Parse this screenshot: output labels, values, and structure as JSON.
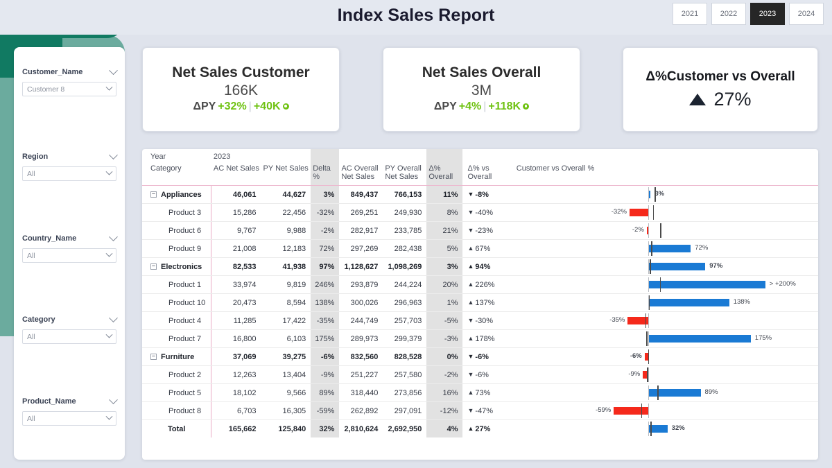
{
  "header": {
    "title": "Index Sales Report",
    "years": [
      {
        "label": "2021",
        "active": false
      },
      {
        "label": "2022",
        "active": false
      },
      {
        "label": "2023",
        "active": true
      },
      {
        "label": "2024",
        "active": false
      }
    ]
  },
  "filters": [
    {
      "label": "Customer_Name",
      "value": "Customer 8"
    },
    {
      "label": "Region",
      "value": "All"
    },
    {
      "label": "Country_Name",
      "value": "All"
    },
    {
      "label": "Category",
      "value": "All"
    },
    {
      "label": "Product_Name",
      "value": "All"
    }
  ],
  "kpis": {
    "customer": {
      "title": "Net Sales Customer",
      "value": "166K",
      "delta_label": "ΔPY",
      "delta_pct": "+32%",
      "delta_abs": "+40K"
    },
    "overall": {
      "title": "Net Sales Overall",
      "value": "3M",
      "delta_label": "ΔPY",
      "delta_pct": "+4%",
      "delta_abs": "+118K"
    },
    "compare": {
      "title": "Δ%Customer vs Overall",
      "value": "27%",
      "direction": "up"
    }
  },
  "table": {
    "year_label": "Year",
    "year_value": "2023",
    "columns": [
      "Category",
      "AC Net Sales",
      "PY Net Sales",
      "Delta %",
      "AC Overall Net Sales",
      "PY Overall Net Sales",
      "Δ% Overall",
      "Δ% vs Overall",
      "Customer vs Overall %"
    ],
    "rows": [
      {
        "category": "Appliances",
        "type": "group",
        "ac_net_sales": "46,061",
        "py_net_sales": "44,627",
        "delta_pct": "3%",
        "ac_overall": "849,437",
        "py_overall": "766,153",
        "d_overall": "11%",
        "d_vs_overall": "-8%",
        "dir": "down",
        "bar_value": 3,
        "bar_label": "3%",
        "ref": 11
      },
      {
        "category": "Product 3",
        "type": "child",
        "ac_net_sales": "15,286",
        "py_net_sales": "22,456",
        "delta_pct": "-32%",
        "ac_overall": "269,251",
        "py_overall": "249,930",
        "d_overall": "8%",
        "d_vs_overall": "-40%",
        "dir": "down",
        "bar_value": -32,
        "bar_label": "-32%",
        "ref": 8
      },
      {
        "category": "Product 6",
        "type": "child",
        "ac_net_sales": "9,767",
        "py_net_sales": "9,988",
        "delta_pct": "-2%",
        "ac_overall": "282,917",
        "py_overall": "233,785",
        "d_overall": "21%",
        "d_vs_overall": "-23%",
        "dir": "down",
        "bar_value": -2,
        "bar_label": "-2%",
        "ref": 21
      },
      {
        "category": "Product 9",
        "type": "child",
        "ac_net_sales": "21,008",
        "py_net_sales": "12,183",
        "delta_pct": "72%",
        "ac_overall": "297,269",
        "py_overall": "282,438",
        "d_overall": "5%",
        "d_vs_overall": "67%",
        "dir": "up",
        "bar_value": 72,
        "bar_label": "72%",
        "ref": 5
      },
      {
        "category": "Electronics",
        "type": "group",
        "ac_net_sales": "82,533",
        "py_net_sales": "41,938",
        "delta_pct": "97%",
        "ac_overall": "1,128,627",
        "py_overall": "1,098,269",
        "d_overall": "3%",
        "d_vs_overall": "94%",
        "dir": "up",
        "bar_value": 97,
        "bar_label": "97%",
        "ref": 3
      },
      {
        "category": "Product 1",
        "type": "child",
        "ac_net_sales": "33,974",
        "py_net_sales": "9,819",
        "delta_pct": "246%",
        "ac_overall": "293,879",
        "py_overall": "244,224",
        "d_overall": "20%",
        "d_vs_overall": "226%",
        "dir": "up",
        "bar_value": 200,
        "bar_label": "> +200%",
        "ref": 20
      },
      {
        "category": "Product 10",
        "type": "child",
        "ac_net_sales": "20,473",
        "py_net_sales": "8,594",
        "delta_pct": "138%",
        "ac_overall": "300,026",
        "py_overall": "296,963",
        "d_overall": "1%",
        "d_vs_overall": "137%",
        "dir": "up",
        "bar_value": 138,
        "bar_label": "138%",
        "ref": 1
      },
      {
        "category": "Product 4",
        "type": "child",
        "ac_net_sales": "11,285",
        "py_net_sales": "17,422",
        "delta_pct": "-35%",
        "ac_overall": "244,749",
        "py_overall": "257,703",
        "d_overall": "-5%",
        "d_vs_overall": "-30%",
        "dir": "down",
        "bar_value": -35,
        "bar_label": "-35%",
        "ref": -5
      },
      {
        "category": "Product 7",
        "type": "child",
        "ac_net_sales": "16,800",
        "py_net_sales": "6,103",
        "delta_pct": "175%",
        "ac_overall": "289,973",
        "py_overall": "299,379",
        "d_overall": "-3%",
        "d_vs_overall": "178%",
        "dir": "up",
        "bar_value": 175,
        "bar_label": "175%",
        "ref": -3
      },
      {
        "category": "Furniture",
        "type": "group",
        "ac_net_sales": "37,069",
        "py_net_sales": "39,275",
        "delta_pct": "-6%",
        "ac_overall": "832,560",
        "py_overall": "828,528",
        "d_overall": "0%",
        "d_vs_overall": "-6%",
        "dir": "down",
        "bar_value": -6,
        "bar_label": "-6%",
        "ref": 0
      },
      {
        "category": "Product 2",
        "type": "child",
        "ac_net_sales": "12,263",
        "py_net_sales": "13,404",
        "delta_pct": "-9%",
        "ac_overall": "251,227",
        "py_overall": "257,580",
        "d_overall": "-2%",
        "d_vs_overall": "-6%",
        "dir": "down",
        "bar_value": -9,
        "bar_label": "-9%",
        "ref": -2
      },
      {
        "category": "Product 5",
        "type": "child",
        "ac_net_sales": "18,102",
        "py_net_sales": "9,566",
        "delta_pct": "89%",
        "ac_overall": "318,440",
        "py_overall": "273,856",
        "d_overall": "16%",
        "d_vs_overall": "73%",
        "dir": "up",
        "bar_value": 89,
        "bar_label": "89%",
        "ref": 16
      },
      {
        "category": "Product 8",
        "type": "child",
        "ac_net_sales": "6,703",
        "py_net_sales": "16,305",
        "delta_pct": "-59%",
        "ac_overall": "262,892",
        "py_overall": "297,091",
        "d_overall": "-12%",
        "d_vs_overall": "-47%",
        "dir": "down",
        "bar_value": -59,
        "bar_label": "-59%",
        "ref": -12
      },
      {
        "category": "Total",
        "type": "total",
        "ac_net_sales": "165,662",
        "py_net_sales": "125,840",
        "delta_pct": "32%",
        "ac_overall": "2,810,624",
        "py_overall": "2,692,950",
        "d_overall": "4%",
        "d_vs_overall": "27%",
        "dir": "up",
        "bar_value": 32,
        "bar_label": "32%",
        "ref": 4
      }
    ]
  },
  "chart_data": {
    "type": "bar",
    "title": "Customer vs Overall %",
    "orientation": "horizontal",
    "categories": [
      "Appliances",
      "Product 3",
      "Product 6",
      "Product 9",
      "Electronics",
      "Product 1",
      "Product 10",
      "Product 4",
      "Product 7",
      "Furniture",
      "Product 2",
      "Product 5",
      "Product 8",
      "Total"
    ],
    "values": [
      3,
      -32,
      -2,
      72,
      97,
      226,
      138,
      -35,
      175,
      -6,
      -9,
      89,
      -59,
      32
    ],
    "value_labels": [
      "3%",
      "-32%",
      "-2%",
      "72%",
      "97%",
      "> +200%",
      "138%",
      "-35%",
      "175%",
      "-6%",
      "-9%",
      "89%",
      "-59%",
      "32%"
    ],
    "reference_markers": [
      11,
      8,
      21,
      5,
      3,
      20,
      1,
      -5,
      -3,
      0,
      -2,
      16,
      -12,
      4
    ],
    "reference_label": "Δ% Overall",
    "xlabel": "",
    "ylabel": "",
    "xlim": [
      -80,
      210
    ],
    "grid": false,
    "legend": "none",
    "colors": {
      "positive": "#1a7ad4",
      "negative": "#f5291b",
      "reference": "#4a4a4a",
      "zero_line": "#b9bcc2"
    }
  }
}
